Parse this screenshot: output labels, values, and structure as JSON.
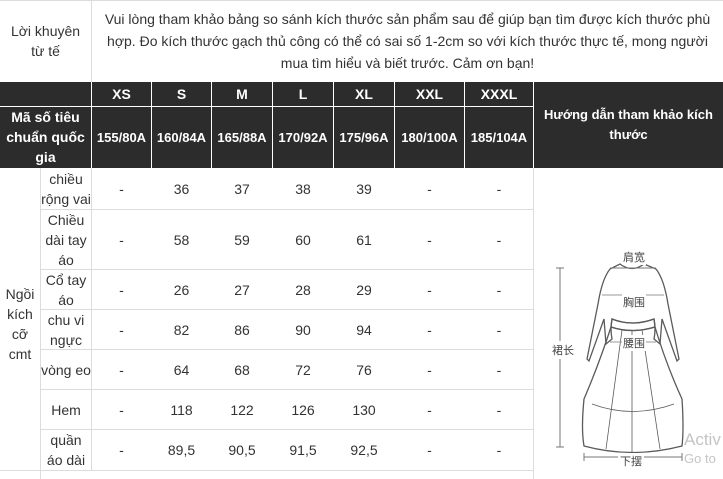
{
  "tip": {
    "label": "Lời khuyên từ tế",
    "text": "Vui lòng tham khảo bảng so sánh kích thước sản phẩm sau để giúp bạn tìm được kích thước phù hợp. Đo kích thước gạch thủ công có thể có sai số 1-2cm so với kích thước thực tế, mong người mua tìm hiểu và biết trước. Cảm ơn bạn!"
  },
  "header": {
    "std_label": "Mã số tiêu chuẩn quốc gia",
    "guide_label": "Hướng dẫn tham khảo kích thước",
    "sizes": [
      "XS",
      "S",
      "M",
      "L",
      "XL",
      "XXL",
      "XXXL"
    ],
    "standards": [
      "155/80A",
      "160/84A",
      "165/88A",
      "170/92A",
      "175/96A",
      "180/100A",
      "185/104A"
    ]
  },
  "table": {
    "group_label": "Ngồi kích cỡ cmt",
    "rows": [
      {
        "label": "chiều rộng vai",
        "values": [
          "-",
          "36",
          "37",
          "38",
          "39",
          "-",
          "-"
        ]
      },
      {
        "label": "Chiều dài tay áo",
        "values": [
          "-",
          "58",
          "59",
          "60",
          "61",
          "-",
          "-"
        ]
      },
      {
        "label": "Cổ tay áo",
        "values": [
          "-",
          "26",
          "27",
          "28",
          "29",
          "-",
          "-"
        ]
      },
      {
        "label": "chu vi ngực",
        "values": [
          "-",
          "82",
          "86",
          "90",
          "94",
          "-",
          "-"
        ]
      },
      {
        "label": "vòng eo",
        "values": [
          "-",
          "64",
          "68",
          "72",
          "76",
          "-",
          "-"
        ]
      },
      {
        "label": "Hem",
        "values": [
          "-",
          "118",
          "122",
          "126",
          "130",
          "-",
          "-"
        ]
      },
      {
        "label": "quần áo dài",
        "values": [
          "-",
          "89,5",
          "90,5",
          "91,5",
          "92,5",
          "-",
          "-"
        ]
      }
    ]
  },
  "diagram": {
    "shoulder": "肩宽",
    "chest": "胸围",
    "waist": "腰围",
    "length": "裙长",
    "hem": "下摆"
  },
  "watermark": {
    "line1": "Activ",
    "line2": "Go to"
  }
}
